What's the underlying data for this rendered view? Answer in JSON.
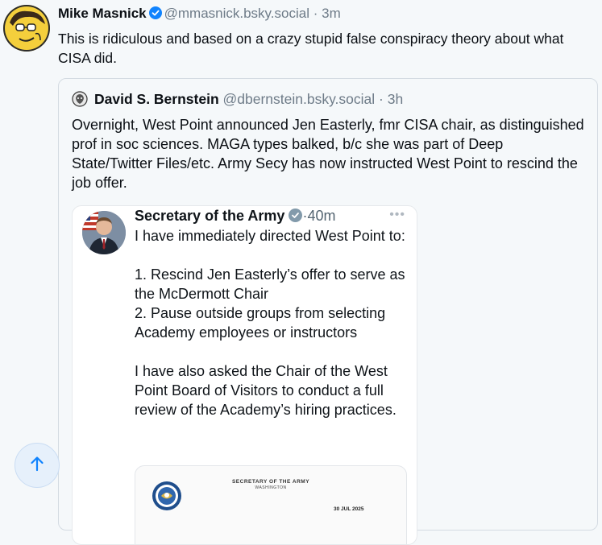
{
  "post": {
    "author_name": "Mike Masnick",
    "handle": "@mmasnick.bsky.social",
    "separator": "·",
    "time": "3m",
    "text": "This is ridiculous and based on a crazy stupid false conspiracy theory about what CISA did."
  },
  "quote": {
    "author_name": "David S. Bernstein",
    "handle": "@dbernstein.bsky.social",
    "separator": "·",
    "time": "3h",
    "text": "Overnight, West Point announced Jen Easterly, fmr CISA chair, as distinguished prof in soc sciences. MAGA types balked, b/c she was part of Deep State/Twitter Files/etc. Army Secy has now instructed West Point to rescind the job offer."
  },
  "embed": {
    "author_name": "Secretary of the Army",
    "separator": "·",
    "time": "40m",
    "more": "•••",
    "text": "I have immediately directed West Point to:\n\n1. Rescind Jen Easterly’s offer to serve as the McDermott Chair\n2. Pause outside groups from selecting Academy employees or instructors\n\nI have also asked the Chair of the West Point Board of Visitors to conduct a full review of the Academy’s hiring practices.",
    "letter": {
      "heading": "SECRETARY OF THE ARMY",
      "subheading": "WASHINGTON",
      "date": "30 JUL 2025"
    }
  },
  "icons": {
    "verified": "verified-badge-icon",
    "scroll_top": "arrow-up-icon"
  },
  "colors": {
    "accent": "#1083fe",
    "background": "#f5f8fa",
    "muted_text": "#6e7b88"
  }
}
